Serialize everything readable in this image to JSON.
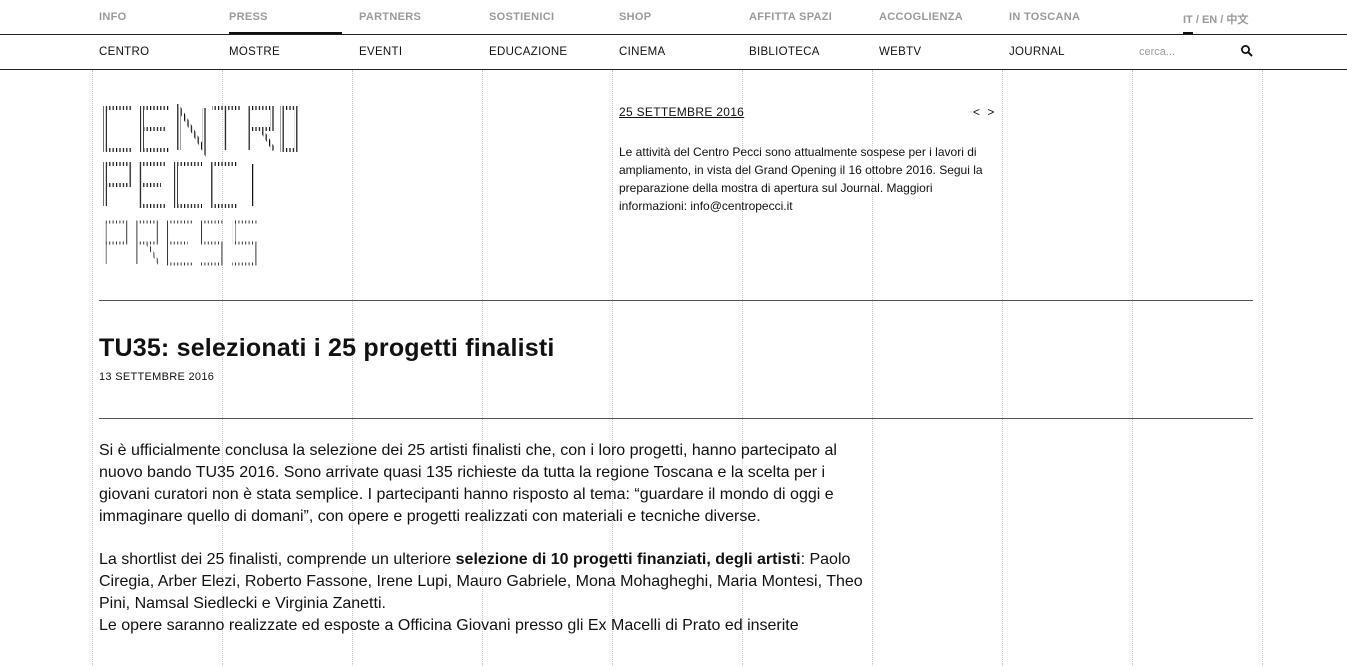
{
  "top_nav": {
    "items": [
      "INFO",
      "PRESS",
      "PARTNERS",
      "SOSTIENICI",
      "SHOP",
      "AFFITTA SPAZI",
      "ACCOGLIENZA",
      "IN TOSCANA"
    ],
    "active": "PRESS",
    "languages": "IT / EN / 中文"
  },
  "sub_nav": {
    "items": [
      "CENTRO",
      "MOSTRE",
      "EVENTI",
      "EDUCAZIONE",
      "CINEMA",
      "BIBLIOTECA",
      "WEBTV",
      "JOURNAL"
    ],
    "search_placeholder": "cerca..."
  },
  "logo": {
    "lines": [
      "CENTRO",
      "PECCI",
      "PRESS"
    ]
  },
  "notice": {
    "date": "25 SETTEMBRE 2016",
    "arrows": "< >",
    "text": "Le attività del Centro Pecci sono attualmente sospese per i lavori di ampliamento, in vista del Grand Opening il 16 ottobre 2016. Segui la preparazione della mostra di apertura sul Journal. Maggiori informazioni: info@centropecci.it"
  },
  "article": {
    "title": "TU35: selezionati i 25 progetti finalisti",
    "date": "13 SETTEMBRE 2016",
    "p1": "Si è ufficialmente conclusa la selezione dei 25 artisti finalisti che, con i loro progetti, hanno partecipato al nuovo bando TU35 2016. Sono arrivate quasi 135 richieste da tutta la regione Toscana e la scelta per i giovani curatori non è stata semplice. I partecipanti hanno risposto al tema: “guardare il mondo di oggi e immaginare quello di domani”, con opere e progetti realizzati con materiali e tecniche diverse.",
    "p2_lead": "La shortlist dei 25 finalisti, comprende un ulteriore ",
    "p2_bold": "selezione di 10 progetti finanziati, degli artisti",
    "p2_rest": ": Paolo Ciregia, Arber Elezi, Roberto Fassone, Irene Lupi, Mauro Gabriele, Mona Mohagheghi, Maria Montesi, Theo Pini, Namsal Siedlecki e Virginia Zanetti.",
    "p3": "Le opere saranno realizzate ed esposte a Officina Giovani presso gli Ex Macelli di Prato ed inserite"
  }
}
